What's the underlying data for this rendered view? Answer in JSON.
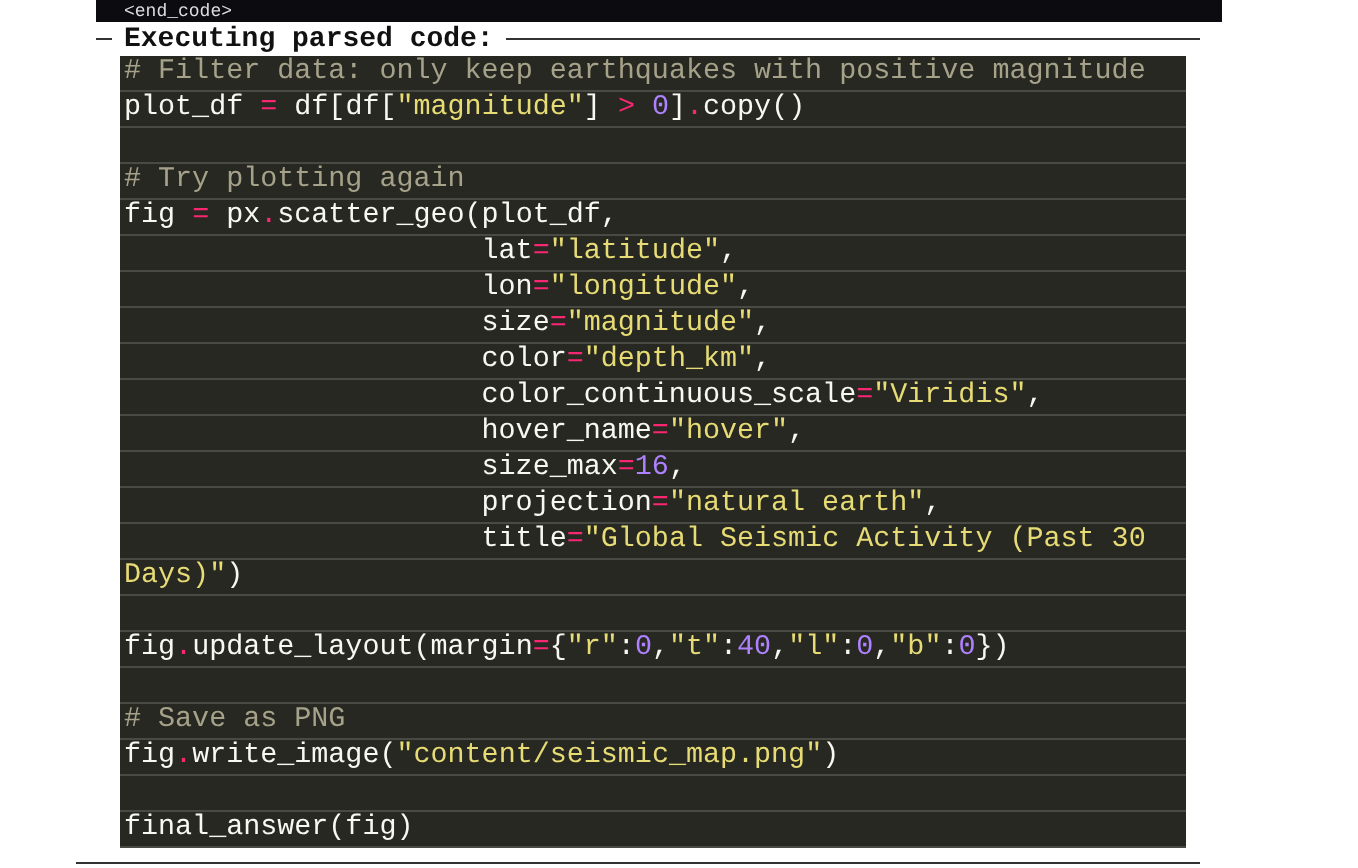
{
  "top_bar": {
    "text": "<end_code>"
  },
  "section": {
    "title": "Executing parsed code:"
  },
  "code_lines": [
    {
      "kind": "code",
      "tokens": [
        {
          "kind": "comment",
          "text": "# Filter data: only keep earthquakes with positive magnitude"
        }
      ]
    },
    {
      "kind": "code",
      "tokens": [
        {
          "kind": "plain",
          "text": "plot_df "
        },
        {
          "kind": "op",
          "text": "="
        },
        {
          "kind": "plain",
          "text": " df[df["
        },
        {
          "kind": "string",
          "text": "\"magnitude\""
        },
        {
          "kind": "plain",
          "text": "] "
        },
        {
          "kind": "op",
          "text": "> "
        },
        {
          "kind": "number",
          "text": "0"
        },
        {
          "kind": "plain",
          "text": "]"
        },
        {
          "kind": "op",
          "text": "."
        },
        {
          "kind": "plain",
          "text": "copy()"
        }
      ]
    },
    {
      "kind": "blank"
    },
    {
      "kind": "code",
      "tokens": [
        {
          "kind": "comment",
          "text": "# Try plotting again"
        }
      ]
    },
    {
      "kind": "code",
      "tokens": [
        {
          "kind": "plain",
          "text": "fig "
        },
        {
          "kind": "op",
          "text": "="
        },
        {
          "kind": "plain",
          "text": " px"
        },
        {
          "kind": "op",
          "text": "."
        },
        {
          "kind": "plain",
          "text": "scatter_geo(plot_df,"
        }
      ]
    },
    {
      "kind": "continuation",
      "tokens": [
        {
          "kind": "plain",
          "text": "lat"
        },
        {
          "kind": "op",
          "text": "="
        },
        {
          "kind": "string",
          "text": "\"latitude\""
        },
        {
          "kind": "plain",
          "text": ","
        }
      ]
    },
    {
      "kind": "continuation",
      "tokens": [
        {
          "kind": "plain",
          "text": "lon"
        },
        {
          "kind": "op",
          "text": "="
        },
        {
          "kind": "string",
          "text": "\"longitude\""
        },
        {
          "kind": "plain",
          "text": ","
        }
      ]
    },
    {
      "kind": "continuation",
      "tokens": [
        {
          "kind": "plain",
          "text": "size"
        },
        {
          "kind": "op",
          "text": "="
        },
        {
          "kind": "string",
          "text": "\"magnitude\""
        },
        {
          "kind": "plain",
          "text": ","
        }
      ]
    },
    {
      "kind": "continuation",
      "tokens": [
        {
          "kind": "plain",
          "text": "color"
        },
        {
          "kind": "op",
          "text": "="
        },
        {
          "kind": "string",
          "text": "\"depth_km\""
        },
        {
          "kind": "plain",
          "text": ","
        }
      ]
    },
    {
      "kind": "continuation",
      "tokens": [
        {
          "kind": "plain",
          "text": "color_continuous_scale"
        },
        {
          "kind": "op",
          "text": "="
        },
        {
          "kind": "string",
          "text": "\"Viridis\""
        },
        {
          "kind": "plain",
          "text": ","
        }
      ]
    },
    {
      "kind": "continuation",
      "tokens": [
        {
          "kind": "plain",
          "text": "hover_name"
        },
        {
          "kind": "op",
          "text": "="
        },
        {
          "kind": "string",
          "text": "\"hover\""
        },
        {
          "kind": "plain",
          "text": ","
        }
      ]
    },
    {
      "kind": "continuation",
      "tokens": [
        {
          "kind": "plain",
          "text": "size_max"
        },
        {
          "kind": "op",
          "text": "="
        },
        {
          "kind": "number",
          "text": "16"
        },
        {
          "kind": "plain",
          "text": ","
        }
      ]
    },
    {
      "kind": "continuation",
      "tokens": [
        {
          "kind": "plain",
          "text": "projection"
        },
        {
          "kind": "op",
          "text": "="
        },
        {
          "kind": "string",
          "text": "\"natural earth\""
        },
        {
          "kind": "plain",
          "text": ","
        }
      ]
    },
    {
      "kind": "continuation",
      "tokens": [
        {
          "kind": "plain",
          "text": "title"
        },
        {
          "kind": "op",
          "text": "="
        },
        {
          "kind": "string",
          "text": "\"Global Seismic Activity (Past 30"
        }
      ]
    },
    {
      "kind": "code",
      "tokens": [
        {
          "kind": "string",
          "text": "Days)\""
        },
        {
          "kind": "plain",
          "text": ")"
        }
      ]
    },
    {
      "kind": "blank"
    },
    {
      "kind": "code",
      "tokens": [
        {
          "kind": "plain",
          "text": "fig"
        },
        {
          "kind": "op",
          "text": "."
        },
        {
          "kind": "plain",
          "text": "update_layout(margin"
        },
        {
          "kind": "op",
          "text": "="
        },
        {
          "kind": "plain",
          "text": "{"
        },
        {
          "kind": "string",
          "text": "\"r\""
        },
        {
          "kind": "plain",
          "text": ":"
        },
        {
          "kind": "number",
          "text": "0"
        },
        {
          "kind": "plain",
          "text": ","
        },
        {
          "kind": "string",
          "text": "\"t\""
        },
        {
          "kind": "plain",
          "text": ":"
        },
        {
          "kind": "number",
          "text": "40"
        },
        {
          "kind": "plain",
          "text": ","
        },
        {
          "kind": "string",
          "text": "\"l\""
        },
        {
          "kind": "plain",
          "text": ":"
        },
        {
          "kind": "number",
          "text": "0"
        },
        {
          "kind": "plain",
          "text": ","
        },
        {
          "kind": "string",
          "text": "\"b\""
        },
        {
          "kind": "plain",
          "text": ":"
        },
        {
          "kind": "number",
          "text": "0"
        },
        {
          "kind": "plain",
          "text": "})"
        }
      ]
    },
    {
      "kind": "blank"
    },
    {
      "kind": "code",
      "tokens": [
        {
          "kind": "comment",
          "text": "# Save as PNG"
        }
      ]
    },
    {
      "kind": "code",
      "tokens": [
        {
          "kind": "plain",
          "text": "fig"
        },
        {
          "kind": "op",
          "text": "."
        },
        {
          "kind": "plain",
          "text": "write_image("
        },
        {
          "kind": "string",
          "text": "\"content/seismic_map.png\""
        },
        {
          "kind": "plain",
          "text": ")"
        }
      ]
    },
    {
      "kind": "blank"
    },
    {
      "kind": "code",
      "tokens": [
        {
          "kind": "plain",
          "text": "final_answer(fig)"
        }
      ]
    }
  ]
}
